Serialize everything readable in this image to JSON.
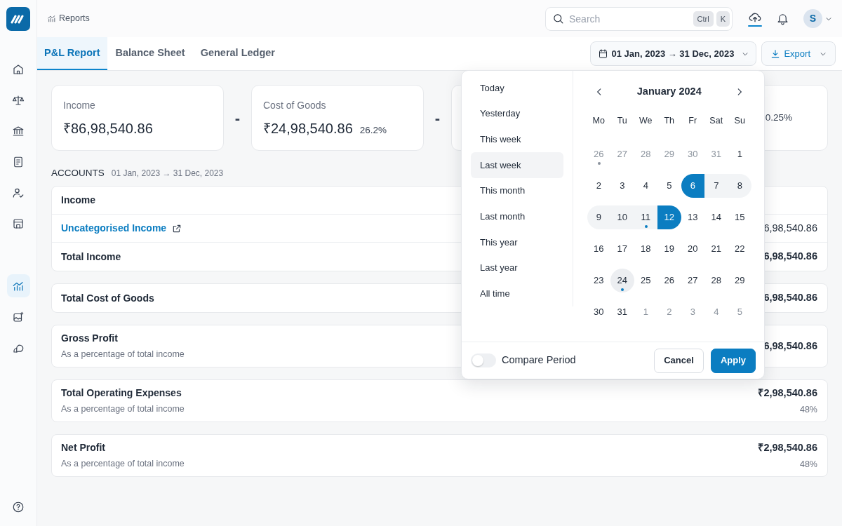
{
  "sidebar": {
    "logo": {
      "kind": "logo"
    },
    "nav_items": [
      {
        "kind": "home",
        "selected": false
      },
      {
        "kind": "scales",
        "selected": false
      },
      {
        "kind": "bank",
        "selected": false
      },
      {
        "kind": "document",
        "selected": false
      },
      {
        "kind": "users",
        "selected": false
      },
      {
        "kind": "store",
        "selected": false
      }
    ],
    "secondary_items": [
      {
        "kind": "reports",
        "selected": true
      },
      {
        "kind": "image",
        "selected": false
      },
      {
        "kind": "chat",
        "selected": false
      }
    ],
    "bottom_items": [
      {
        "kind": "help",
        "selected": false
      }
    ]
  },
  "topbar": {
    "breadcrumb": "Reports",
    "search": {
      "placeholder": "Search",
      "shortcut": [
        "Ctrl",
        "K"
      ]
    },
    "avatar": "S"
  },
  "tabs": [
    {
      "label": "P&L Report",
      "selected": true
    },
    {
      "label": "Balance Sheet",
      "selected": false
    },
    {
      "label": "General Ledger",
      "selected": false
    }
  ],
  "date_range_button": "01 Jan, 2023 → 31 Dec, 2023",
  "export_button": "Export",
  "summary": [
    {
      "kind": "card",
      "label": "Income",
      "value": "₹86,98,540.86"
    },
    {
      "kind": "operator",
      "text": "-"
    },
    {
      "kind": "card",
      "label": "Cost of Goods",
      "value": "₹24,98,540.86",
      "percent": "26.2%"
    },
    {
      "kind": "operator",
      "text": "-"
    },
    {
      "kind": "card",
      "percent": "0.25%"
    }
  ],
  "accounts": {
    "title": "ACCOUNTS",
    "range": "01 Jan, 2023 → 31 Dec, 2023",
    "sections": [
      {
        "rows": [
          {
            "kind": "header",
            "label": "Income"
          },
          {
            "kind": "link",
            "label": "Uncategorised Income",
            "amount": "6,98,540.86"
          },
          {
            "kind": "total",
            "label": "Total Income",
            "amount": "6,98,540.86"
          }
        ]
      },
      {
        "rows": [
          {
            "kind": "total",
            "label": "Total Cost of Goods",
            "amount": "6,98,540.86"
          }
        ]
      },
      {
        "rows": [
          {
            "kind": "total",
            "label": "Gross Profit",
            "note": "As a percentage of total income",
            "amount": "6,98,540.86"
          }
        ]
      },
      {
        "rows": [
          {
            "kind": "total",
            "label": "Total Operating Expenses",
            "note": "As a percentage of total income",
            "amount": "₹2,98,540.86",
            "percent": "48%"
          }
        ]
      },
      {
        "rows": [
          {
            "kind": "total",
            "label": "Net Profit",
            "note": "As a percentage of total income",
            "amount": "₹2,98,540.86",
            "percent": "48%"
          }
        ]
      }
    ]
  },
  "date_picker": {
    "presets": [
      {
        "label": "Today",
        "selected": false
      },
      {
        "label": "Yesterday",
        "selected": false
      },
      {
        "label": "This week",
        "selected": false
      },
      {
        "label": "Last week",
        "selected": true
      },
      {
        "label": "This month",
        "selected": false
      },
      {
        "label": "Last month",
        "selected": false
      },
      {
        "label": "This year",
        "selected": false
      },
      {
        "label": "Last year",
        "selected": false
      },
      {
        "label": "All time",
        "selected": false
      }
    ],
    "month": "January 2024",
    "weekdays": [
      "Mo",
      "Tu",
      "We",
      "Th",
      "Fr",
      "Sat",
      "Su"
    ],
    "weeks": [
      [
        {
          "day": "26",
          "outside": true,
          "selected": false,
          "in_range": false,
          "today": false,
          "marked": true
        },
        {
          "day": "27",
          "outside": true,
          "selected": false,
          "in_range": false,
          "today": false,
          "marked": false
        },
        {
          "day": "28",
          "outside": true,
          "selected": false,
          "in_range": false,
          "today": false,
          "marked": false
        },
        {
          "day": "29",
          "outside": true,
          "selected": false,
          "in_range": false,
          "today": false,
          "marked": false
        },
        {
          "day": "30",
          "outside": true,
          "selected": false,
          "in_range": false,
          "today": false,
          "marked": false
        },
        {
          "day": "31",
          "outside": true,
          "selected": false,
          "in_range": false,
          "today": false,
          "marked": false
        },
        {
          "day": "1",
          "outside": false,
          "selected": false,
          "in_range": false,
          "today": false,
          "marked": false
        }
      ],
      [
        {
          "day": "2",
          "outside": false,
          "selected": false,
          "in_range": false,
          "today": false,
          "marked": false
        },
        {
          "day": "3",
          "outside": false,
          "selected": false,
          "in_range": false,
          "today": false,
          "marked": false
        },
        {
          "day": "4",
          "outside": false,
          "selected": false,
          "in_range": false,
          "today": false,
          "marked": false
        },
        {
          "day": "5",
          "outside": false,
          "selected": false,
          "in_range": false,
          "today": false,
          "marked": false
        },
        {
          "day": "6",
          "outside": false,
          "selected": true,
          "in_range": true,
          "today": false,
          "marked": false
        },
        {
          "day": "7",
          "outside": false,
          "selected": false,
          "in_range": true,
          "today": false,
          "marked": false
        },
        {
          "day": "8",
          "outside": false,
          "selected": false,
          "in_range": true,
          "today": false,
          "marked": false
        }
      ],
      [
        {
          "day": "9",
          "outside": false,
          "selected": false,
          "in_range": true,
          "today": false,
          "marked": false
        },
        {
          "day": "10",
          "outside": false,
          "selected": false,
          "in_range": true,
          "today": false,
          "marked": false
        },
        {
          "day": "11",
          "outside": false,
          "selected": false,
          "in_range": true,
          "today": false,
          "marked": true
        },
        {
          "day": "12",
          "outside": false,
          "selected": true,
          "in_range": true,
          "today": false,
          "marked": false
        },
        {
          "day": "13",
          "outside": false,
          "selected": false,
          "in_range": false,
          "today": false,
          "marked": false
        },
        {
          "day": "14",
          "outside": false,
          "selected": false,
          "in_range": false,
          "today": false,
          "marked": false
        },
        {
          "day": "15",
          "outside": false,
          "selected": false,
          "in_range": false,
          "today": false,
          "marked": false
        }
      ],
      [
        {
          "day": "16",
          "outside": false,
          "selected": false,
          "in_range": false,
          "today": false,
          "marked": false
        },
        {
          "day": "17",
          "outside": false,
          "selected": false,
          "in_range": false,
          "today": false,
          "marked": false
        },
        {
          "day": "18",
          "outside": false,
          "selected": false,
          "in_range": false,
          "today": false,
          "marked": false
        },
        {
          "day": "19",
          "outside": false,
          "selected": false,
          "in_range": false,
          "today": false,
          "marked": false
        },
        {
          "day": "20",
          "outside": false,
          "selected": false,
          "in_range": false,
          "today": false,
          "marked": false
        },
        {
          "day": "21",
          "outside": false,
          "selected": false,
          "in_range": false,
          "today": false,
          "marked": false
        },
        {
          "day": "22",
          "outside": false,
          "selected": false,
          "in_range": false,
          "today": false,
          "marked": false
        }
      ],
      [
        {
          "day": "23",
          "outside": false,
          "selected": false,
          "in_range": false,
          "today": false,
          "marked": false
        },
        {
          "day": "24",
          "outside": false,
          "selected": false,
          "in_range": false,
          "today": true,
          "marked": true
        },
        {
          "day": "25",
          "outside": false,
          "selected": false,
          "in_range": false,
          "today": false,
          "marked": false
        },
        {
          "day": "26",
          "outside": false,
          "selected": false,
          "in_range": false,
          "today": false,
          "marked": false
        },
        {
          "day": "27",
          "outside": false,
          "selected": false,
          "in_range": false,
          "today": false,
          "marked": false
        },
        {
          "day": "28",
          "outside": false,
          "selected": false,
          "in_range": false,
          "today": false,
          "marked": false
        },
        {
          "day": "29",
          "outside": false,
          "selected": false,
          "in_range": false,
          "today": false,
          "marked": false
        }
      ],
      [
        {
          "day": "30",
          "outside": false,
          "selected": false,
          "in_range": false,
          "today": false,
          "marked": false
        },
        {
          "day": "31",
          "outside": false,
          "selected": false,
          "in_range": false,
          "today": false,
          "marked": false
        },
        {
          "day": "1",
          "outside": true,
          "selected": false,
          "in_range": false,
          "today": false,
          "marked": false
        },
        {
          "day": "2",
          "outside": true,
          "selected": false,
          "in_range": false,
          "today": false,
          "marked": false
        },
        {
          "day": "3",
          "outside": true,
          "selected": false,
          "in_range": false,
          "today": false,
          "marked": false
        },
        {
          "day": "4",
          "outside": true,
          "selected": false,
          "in_range": false,
          "today": false,
          "marked": false
        },
        {
          "day": "5",
          "outside": true,
          "selected": false,
          "in_range": false,
          "today": false,
          "marked": false
        }
      ]
    ],
    "compare": {
      "label": "Compare Period",
      "on": false
    },
    "buttons": [
      {
        "kind": "secondary",
        "label": "Cancel"
      },
      {
        "kind": "primary",
        "label": "Apply"
      }
    ]
  }
}
